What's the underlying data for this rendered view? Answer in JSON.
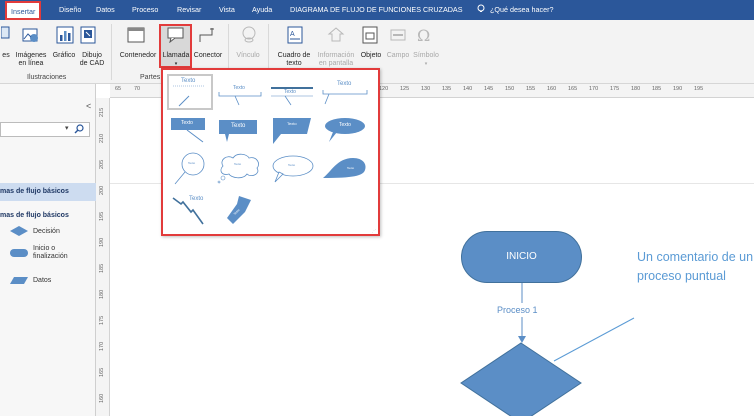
{
  "tabs": [
    {
      "label": "Insertar",
      "active": true
    },
    {
      "label": "Diseño"
    },
    {
      "label": "Datos"
    },
    {
      "label": "Proceso"
    },
    {
      "label": "Revisar"
    },
    {
      "label": "Vista"
    },
    {
      "label": "Ayuda"
    },
    {
      "label": "DIAGRAMA DE FLUJO DE FUNCIONES CRUZADAS"
    }
  ],
  "tell_me": "¿Qué desea hacer?",
  "ribbon": {
    "pictures": "es",
    "online_images_1": "Imágenes",
    "online_images_2": "en línea",
    "chart": "Gráfico",
    "cad_1": "Dibujo",
    "cad_2": "de CAD",
    "group_illustrations": "Ilustraciones",
    "container": "Contenedor",
    "callout": "Llamada",
    "connector": "Conector",
    "link": "Vínculo",
    "group_parts": "Partes",
    "textbox_1": "Cuadro de",
    "textbox_2": "texto",
    "info_1": "Información",
    "info_2": "en pantalla",
    "object": "Objeto",
    "field": "Campo",
    "symbol": "Símbolo"
  },
  "left_pane": {
    "collapse": "<",
    "stencil_selected": "mas de flujo básicos",
    "stencil_header": "mas de flujo básicos",
    "shapes": [
      {
        "label": "Decisión",
        "icon": "diamond-shape-icon"
      },
      {
        "label": "Inicio o finalización",
        "label_1": "Inicio o",
        "label_2": "finalización",
        "icon": "terminator-shape-icon"
      },
      {
        "label": "Datos",
        "icon": "parallelogram-shape-icon"
      }
    ]
  },
  "hruler": [
    "65",
    "70",
    "120",
    "125",
    "130",
    "135",
    "140",
    "145",
    "150",
    "155",
    "160",
    "165",
    "170",
    "175",
    "180",
    "185",
    "190",
    "195"
  ],
  "vruler": [
    "215",
    "210",
    "205",
    "200",
    "195",
    "190",
    "185",
    "180",
    "175",
    "170",
    "165",
    "160",
    "155"
  ],
  "gallery": {
    "texto": "Texto"
  },
  "flowchart": {
    "start": "INICIO",
    "process_label": "Proceso 1",
    "comment": "Un comentario de un proceso puntual",
    "shape_color": "#5b8ec6",
    "comment_color": "#5b9bd5"
  },
  "colors": {
    "ribbon_blue": "#2b579a",
    "highlight_red": "#e23b3b"
  }
}
